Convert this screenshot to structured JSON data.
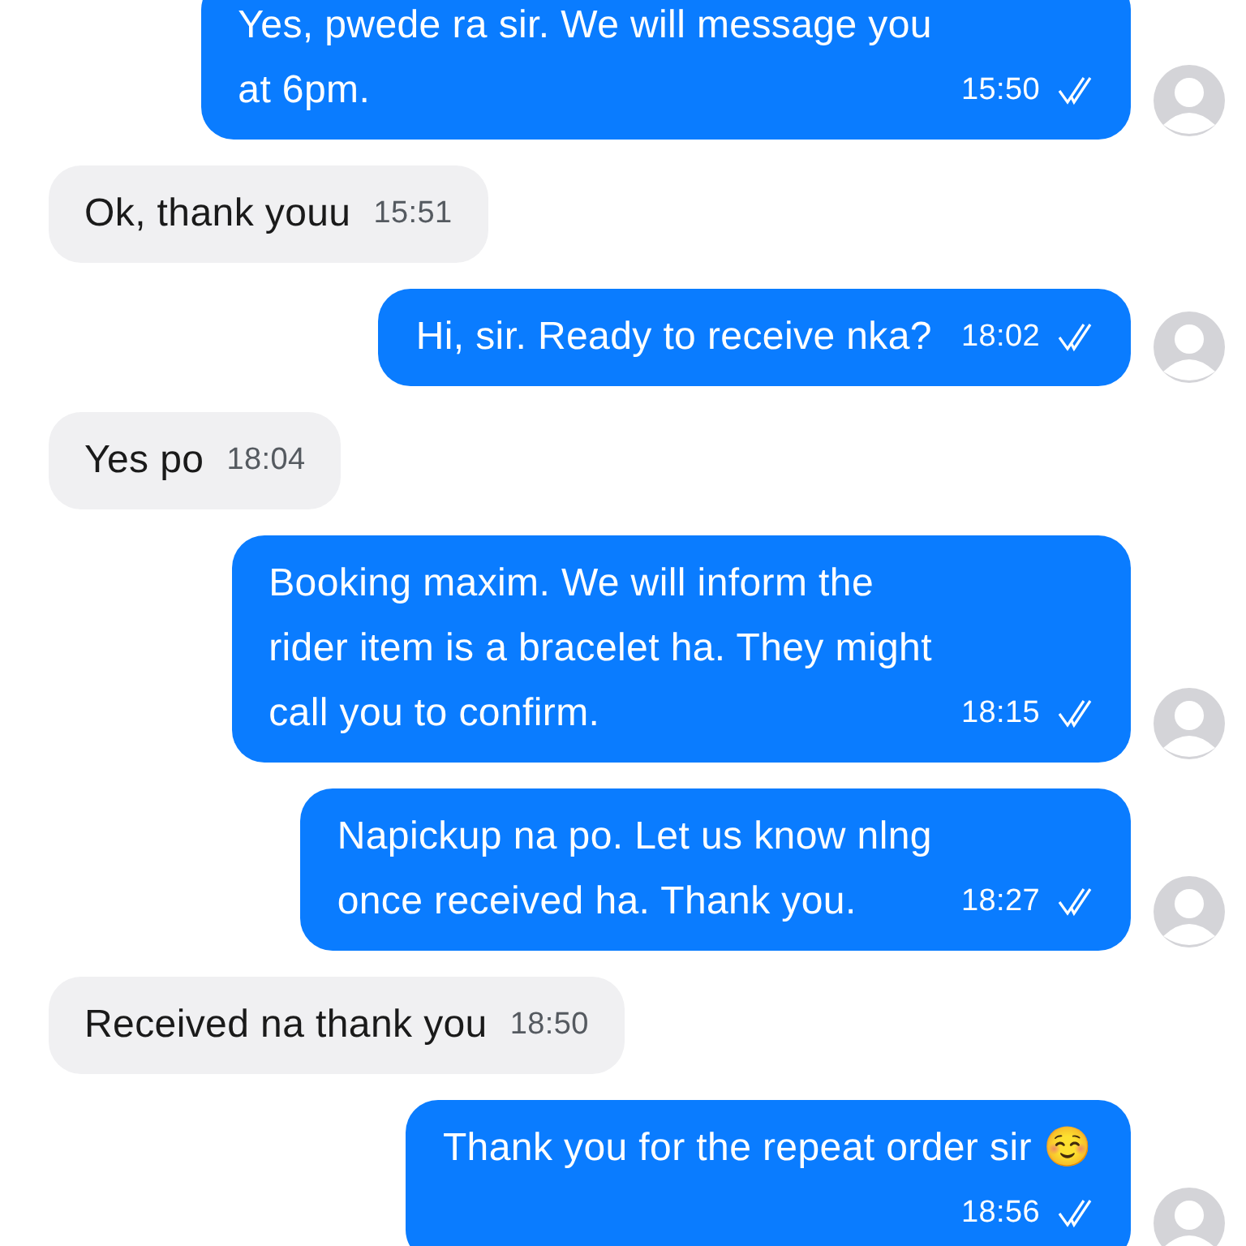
{
  "messages": [
    {
      "kind": "outgoing",
      "lines": [
        "Yes, pwede ra sir. We will message you",
        "at 6pm."
      ],
      "time": "15:50",
      "read": true
    },
    {
      "kind": "incoming",
      "lines": [
        "Ok, thank youu"
      ],
      "time": "15:51"
    },
    {
      "kind": "outgoing",
      "lines": [
        "Hi, sir. Ready to receive nka?"
      ],
      "time": "18:02",
      "read": true
    },
    {
      "kind": "incoming",
      "lines": [
        "Yes po"
      ],
      "time": "18:04"
    },
    {
      "kind": "outgoing",
      "lines": [
        "Booking maxim. We will inform the",
        "rider item is a bracelet ha. They might",
        "call you to confirm."
      ],
      "time": "18:15",
      "read": true
    },
    {
      "kind": "outgoing",
      "lines": [
        "Napickup na po. Let us know nlng",
        "once received ha. Thank you."
      ],
      "time": "18:27",
      "read": true
    },
    {
      "kind": "incoming",
      "lines": [
        "Received na thank you"
      ],
      "time": "18:50"
    },
    {
      "kind": "outgoing",
      "lines": [
        "Thank you for the repeat order sir ☺️"
      ],
      "time": "18:56",
      "read": true,
      "time_below": true
    }
  ]
}
